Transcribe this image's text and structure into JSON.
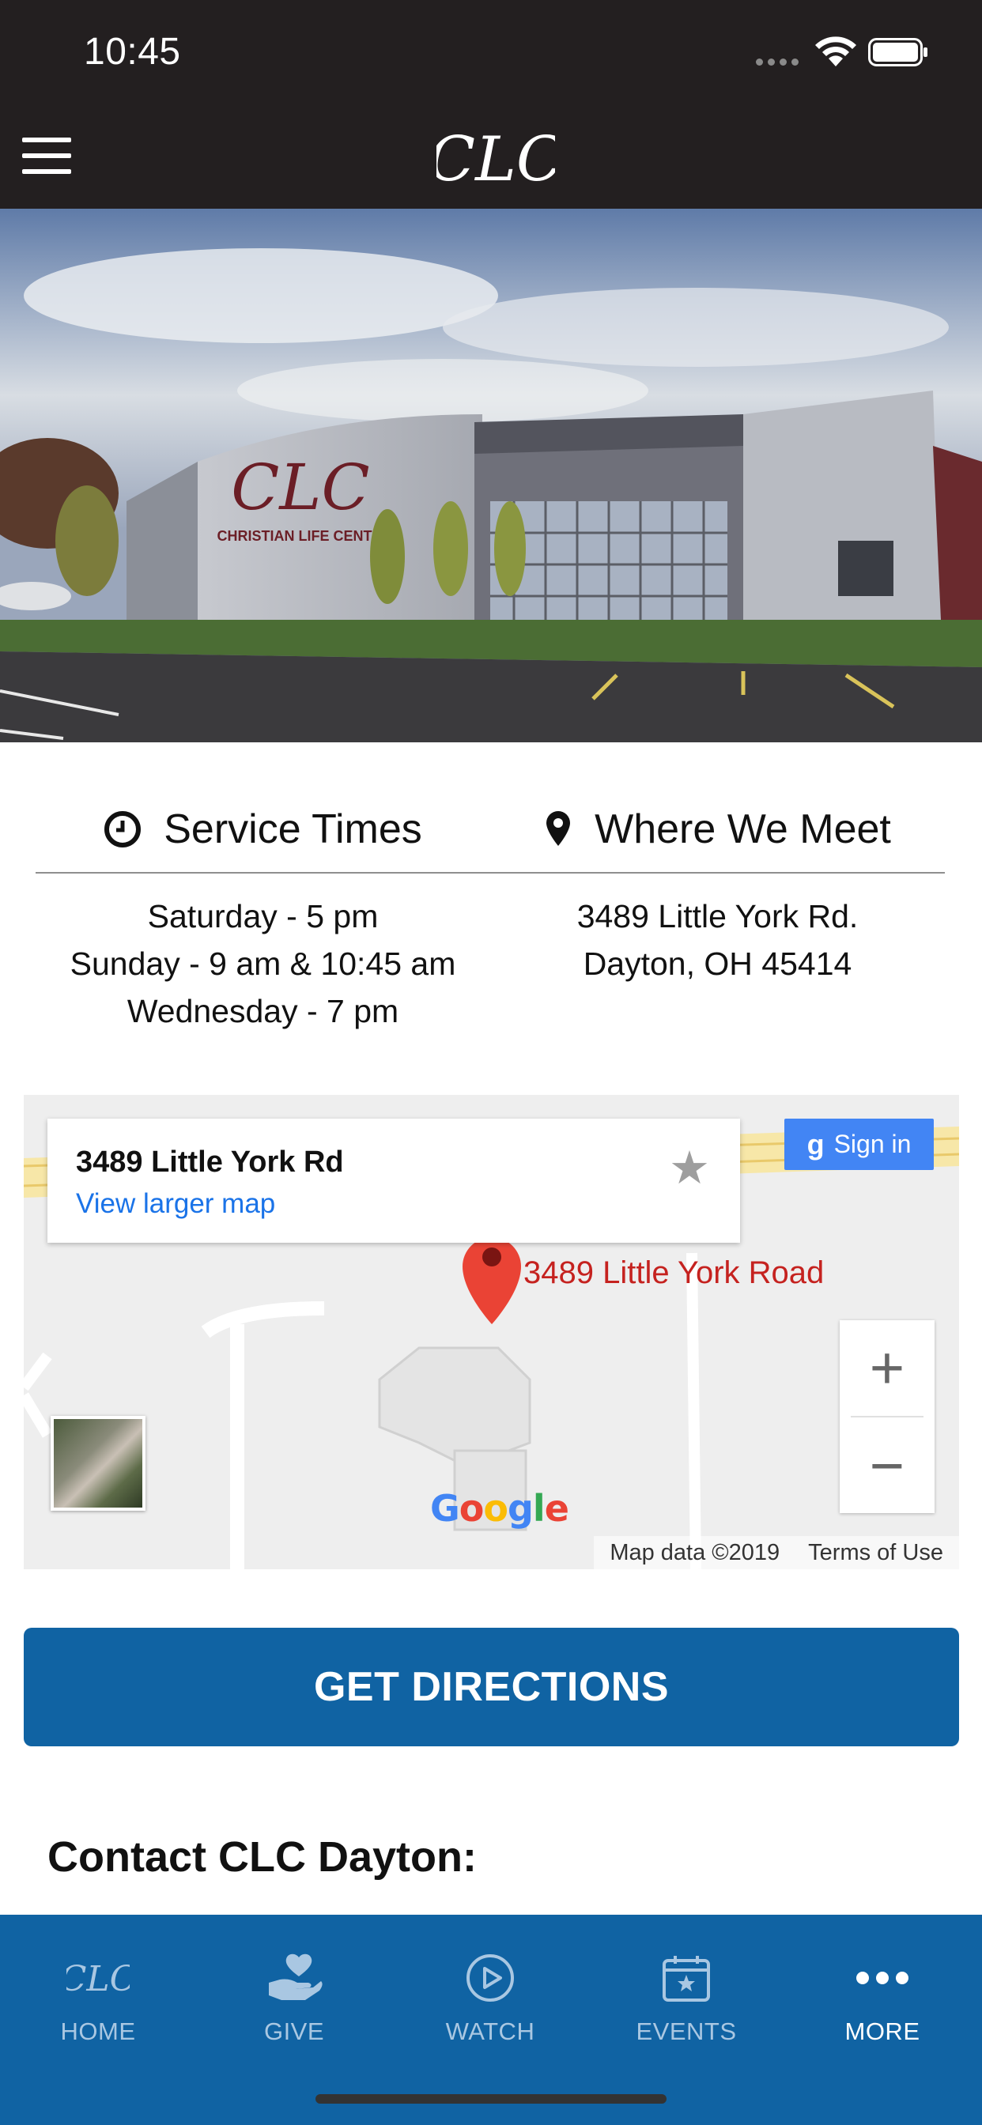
{
  "status_bar": {
    "time": "10:45"
  },
  "header": {
    "logo_text": "CLC",
    "menu_icon": "hamburger-icon"
  },
  "hero": {
    "sign_text": "CLC",
    "sign_subtext": "CHRISTIAN LIFE CENTER"
  },
  "service_times": {
    "title": "Service Times",
    "icon": "clock-icon",
    "lines": [
      "Saturday - 5 pm",
      "Sunday - 9 am & 10:45 am",
      "Wednesday - 7 pm"
    ]
  },
  "where_we_meet": {
    "title": "Where We Meet",
    "icon": "map-pin-icon",
    "lines": [
      "3489 Little York Rd.",
      "Dayton, OH 45414"
    ]
  },
  "map": {
    "card_address": "3489 Little York Rd",
    "card_link": "View larger map",
    "sign_in": "Sign in",
    "marker_label": "3489 Little York Road",
    "zoom_in": "+",
    "zoom_out": "−",
    "google": [
      "G",
      "o",
      "o",
      "g",
      "l",
      "e"
    ],
    "google_colors": [
      "#4285F4",
      "#EA4335",
      "#FBBC05",
      "#4285F4",
      "#34A853",
      "#EA4335"
    ],
    "data_text": "Map data ©2019",
    "terms_text": "Terms of Use"
  },
  "directions_button": "GET DIRECTIONS",
  "contact_heading": "Contact CLC Dayton:",
  "tabs": [
    {
      "label": "HOME",
      "icon": "clc-logo-icon"
    },
    {
      "label": "GIVE",
      "icon": "heart-hand-icon"
    },
    {
      "label": "WATCH",
      "icon": "play-circle-icon"
    },
    {
      "label": "EVENTS",
      "icon": "calendar-icon"
    },
    {
      "label": "MORE",
      "icon": "more-dots-icon"
    }
  ],
  "active_tab": "MORE",
  "colors": {
    "header_bg": "#231f20",
    "accent_blue": "#1063a3",
    "map_marker": "#ea4335",
    "link_blue": "#1a73e8"
  }
}
